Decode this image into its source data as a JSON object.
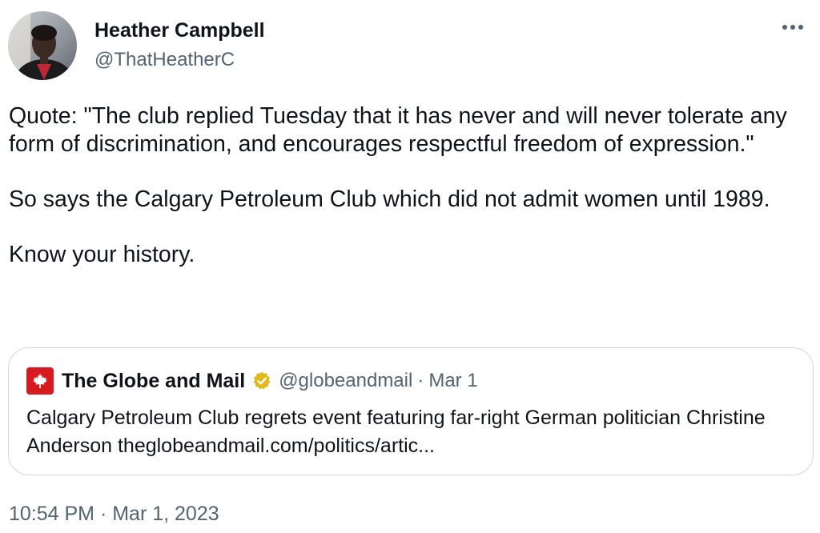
{
  "author": {
    "display_name": "Heather Campbell",
    "handle": "@ThatHeatherC"
  },
  "more_icon": "more-horizontal-icon",
  "tweet": {
    "paragraphs": [
      "Quote: \"The club replied Tuesday that it has never and will never tolerate any form of discrimination, and encourages respectful freedom of expression.\"",
      "So says the Calgary Petroleum Club which did not admit women until 1989.",
      "Know your history."
    ]
  },
  "quoted_tweet": {
    "display_name": "The Globe and Mail",
    "handle": "@globeandmail",
    "separator": "·",
    "date": "Mar 1",
    "text": "Calgary Petroleum Club regrets event featuring far-right German politician Christine Anderson theglobeandmail.com/politics/artic...",
    "avatar_icon": "maple-leaf-icon",
    "avatar_color": "#d71920",
    "verified_icon": "verified-badge-icon",
    "verified_color": "#e2b719"
  },
  "timestamp": "10:54 PM · Mar 1, 2023",
  "colors": {
    "text_primary": "#0f1419",
    "text_secondary": "#536471",
    "border": "#cfd9de"
  }
}
